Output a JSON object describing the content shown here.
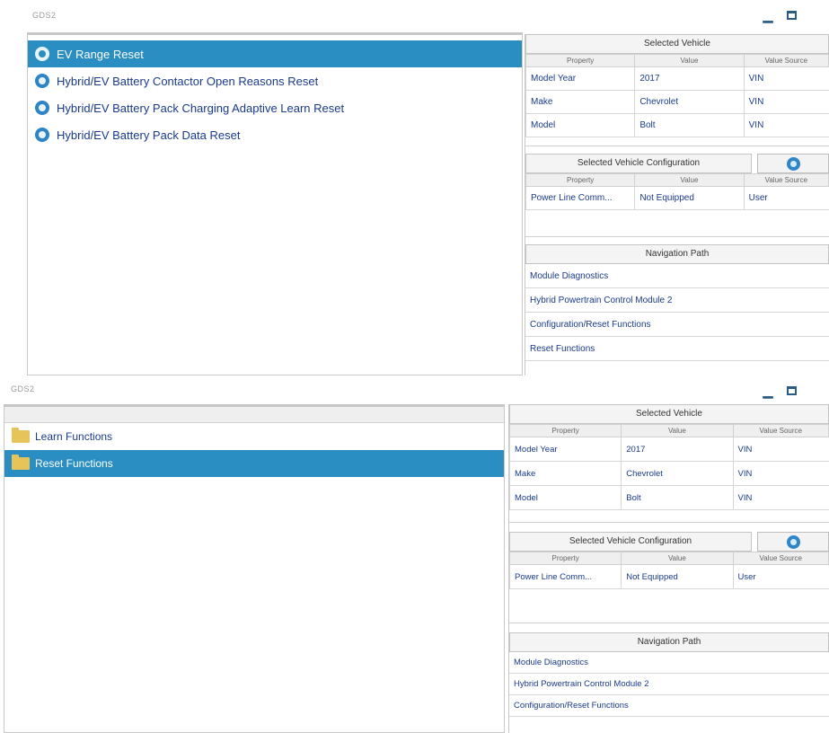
{
  "top": {
    "app_title": "GDS2",
    "list_items": [
      {
        "label": "EV Range Reset",
        "selected": true
      },
      {
        "label": "Hybrid/EV Battery Contactor Open Reasons Reset",
        "selected": false
      },
      {
        "label": "Hybrid/EV Battery Pack Charging Adaptive Learn Reset",
        "selected": false
      },
      {
        "label": "Hybrid/EV Battery Pack Data Reset",
        "selected": false
      }
    ],
    "selected_vehicle": {
      "title": "Selected Vehicle",
      "columns": [
        "Property",
        "Value",
        "Value Source"
      ],
      "rows": [
        [
          "Model Year",
          "2017",
          "VIN"
        ],
        [
          "Make",
          "Chevrolet",
          "VIN"
        ],
        [
          "Model",
          "Bolt",
          "VIN"
        ]
      ]
    },
    "configuration": {
      "title": "Selected Vehicle Configuration",
      "columns": [
        "Property",
        "Value",
        "Value Source"
      ],
      "rows": [
        [
          "Power Line Comm...",
          "Not Equipped",
          "User"
        ]
      ]
    },
    "navigation": {
      "title": "Navigation Path",
      "items": [
        "Module Diagnostics",
        "Hybrid Powertrain Control Module 2",
        "Configuration/Reset Functions",
        "Reset Functions"
      ]
    }
  },
  "bottom": {
    "app_title": "GDS2",
    "list_items": [
      {
        "label": "Learn Functions",
        "selected": false
      },
      {
        "label": "Reset Functions",
        "selected": true
      }
    ],
    "selected_vehicle": {
      "title": "Selected Vehicle",
      "columns": [
        "Property",
        "Value",
        "Value Source"
      ],
      "rows": [
        [
          "Model Year",
          "2017",
          "VIN"
        ],
        [
          "Make",
          "Chevrolet",
          "VIN"
        ],
        [
          "Model",
          "Bolt",
          "VIN"
        ]
      ]
    },
    "configuration": {
      "title": "Selected Vehicle Configuration",
      "columns": [
        "Property",
        "Value",
        "Value Source"
      ],
      "rows": [
        [
          "Power Line Comm...",
          "Not Equipped",
          "User"
        ]
      ]
    },
    "navigation": {
      "title": "Navigation Path",
      "items": [
        "Module Diagnostics",
        "Hybrid Powertrain Control Module 2",
        "Configuration/Reset Functions"
      ]
    }
  },
  "colors": {
    "selection": "#2a8ec2",
    "link_text": "#1a3a8a",
    "icon_blue": "#2d84c6",
    "folder": "#e7c45a"
  }
}
